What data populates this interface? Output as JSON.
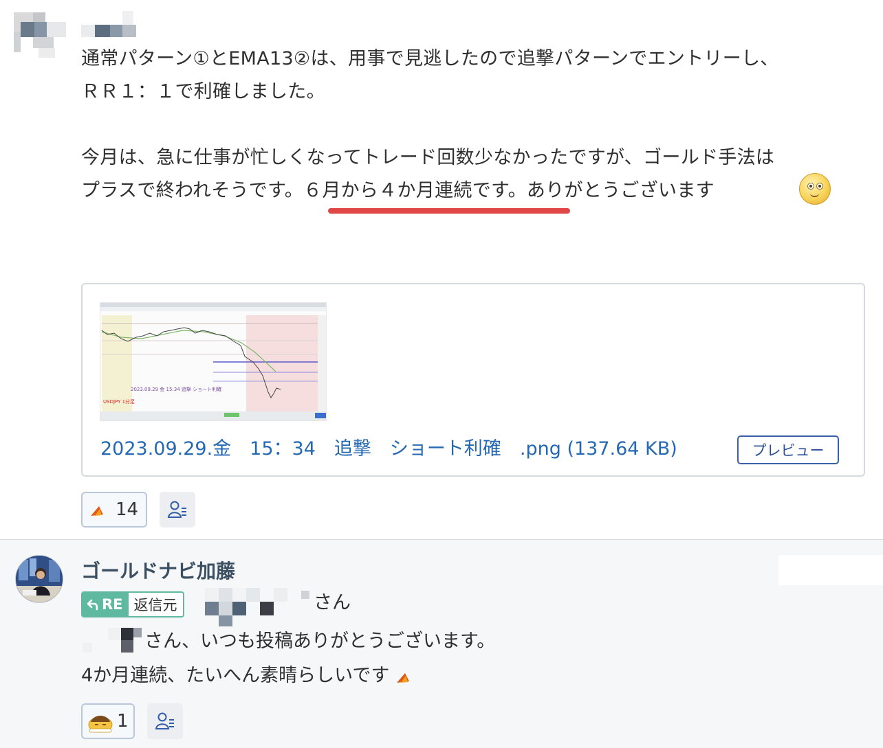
{
  "post": {
    "line1": "通常パターン①とEMA13②は、用事で見逃したので追撃パターンでエントリーし、",
    "line2": "ＲＲ１：１で利確しました。",
    "line3": "今月は、急に仕事が忙しくなってトレード回数少なかったですが、ゴールド手法は",
    "line4_a": "プラスで終われそうです。",
    "line4_b": "６月から４か月連続です。",
    "line4_c": "ありがとうございます",
    "emoji_icon": "smile-emoji-icon",
    "attachment": {
      "filename": "2023.09.29.金　15：34　追撃　ショート利確　.png (137.64 KB)",
      "preview_label": "プレビュー",
      "thumb_caption": "2023.09.29 金 15:34 追撃 ショート利確",
      "thumb_pair": "USDJPY 1分足"
    },
    "reaction_count": "14",
    "highlight_color": "#e04848"
  },
  "reply": {
    "author": "ゴールドナビ加藤",
    "re_label": "RE",
    "source_label": "返信元",
    "addressee_suffix": "さん",
    "line1": "さん、いつも投稿ありがとうございます。",
    "line2": "4か月連続、たいへん素晴らしいです",
    "reaction_count": "1",
    "accent_color": "#5fb9a0"
  }
}
